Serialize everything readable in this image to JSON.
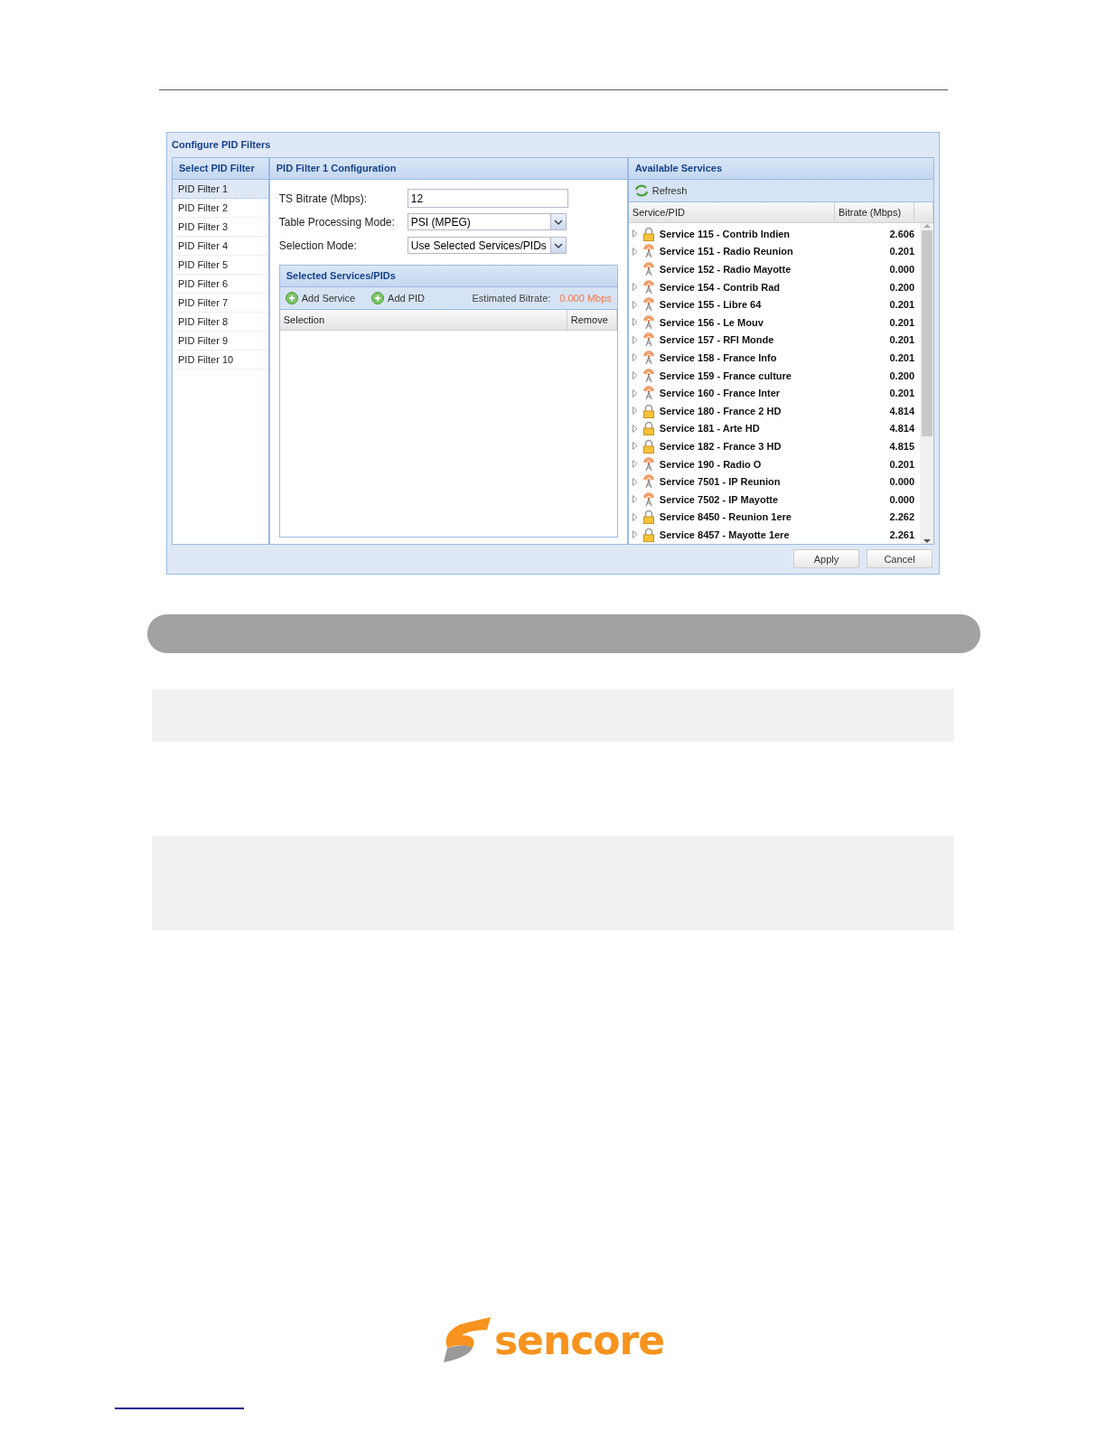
{
  "dialog": {
    "title": "Configure PID Filters",
    "filter_list": {
      "title": "Select PID Filter",
      "items": [
        {
          "label": "PID Filter 1",
          "selected": true
        },
        {
          "label": "PID Filter 2",
          "selected": false
        },
        {
          "label": "PID Filter 3",
          "selected": false
        },
        {
          "label": "PID Filter 4",
          "selected": false
        },
        {
          "label": "PID Filter 5",
          "selected": false
        },
        {
          "label": "PID Filter 6",
          "selected": false
        },
        {
          "label": "PID Filter 7",
          "selected": false
        },
        {
          "label": "PID Filter 8",
          "selected": false
        },
        {
          "label": "PID Filter 9",
          "selected": false
        },
        {
          "label": "PID Filter 10",
          "selected": false
        }
      ]
    },
    "configuration": {
      "title": "PID Filter 1 Configuration",
      "fields": [
        {
          "kind": "text",
          "label": "TS Bitrate (Mbps):",
          "value": "12"
        },
        {
          "kind": "select",
          "label": "Table Processing Mode:",
          "value": "PSI (MPEG)"
        },
        {
          "kind": "select",
          "label": "Selection Mode:",
          "value": "Use Selected Services/PIDs"
        }
      ],
      "selected": {
        "title": "Selected Services/PIDs",
        "buttons": [
          "Add Service",
          "Add PID"
        ],
        "estimate_label": "Estimated Bitrate:",
        "estimate_value": "0.000 Mbps",
        "columns": [
          "Selection",
          "Remove"
        ]
      }
    },
    "available": {
      "title": "Available Services",
      "refresh": "Refresh",
      "columns": [
        "Service/PID",
        "Bitrate (Mbps)"
      ],
      "rows": [
        {
          "kind": "lock",
          "expandable": true,
          "name": "Service 115 - Contrib Indien",
          "bitrate": "2.606"
        },
        {
          "kind": "radio",
          "expandable": true,
          "name": "Service 151 - Radio Reunion",
          "bitrate": "0.201"
        },
        {
          "kind": "radio",
          "expandable": false,
          "name": "Service 152 - Radio Mayotte",
          "bitrate": "0.000"
        },
        {
          "kind": "radio",
          "expandable": true,
          "name": "Service 154 - Contrib Rad",
          "bitrate": "0.200"
        },
        {
          "kind": "radio",
          "expandable": true,
          "name": "Service 155 - Libre 64",
          "bitrate": "0.201"
        },
        {
          "kind": "radio",
          "expandable": true,
          "name": "Service 156 - Le Mouv",
          "bitrate": "0.201"
        },
        {
          "kind": "radio",
          "expandable": true,
          "name": "Service 157 - RFI Monde",
          "bitrate": "0.201"
        },
        {
          "kind": "radio",
          "expandable": true,
          "name": "Service 158 - France Info",
          "bitrate": "0.201"
        },
        {
          "kind": "radio",
          "expandable": true,
          "name": "Service 159 - France culture",
          "bitrate": "0.200"
        },
        {
          "kind": "radio",
          "expandable": true,
          "name": "Service 160 - France Inter",
          "bitrate": "0.201"
        },
        {
          "kind": "lock",
          "expandable": true,
          "name": "Service 180 - France 2 HD",
          "bitrate": "4.814"
        },
        {
          "kind": "lock",
          "expandable": true,
          "name": "Service 181 - Arte HD",
          "bitrate": "4.814"
        },
        {
          "kind": "lock",
          "expandable": true,
          "name": "Service 182 - France 3 HD",
          "bitrate": "4.815"
        },
        {
          "kind": "radio",
          "expandable": true,
          "name": "Service 190 - Radio O",
          "bitrate": "0.201"
        },
        {
          "kind": "radio",
          "expandable": true,
          "name": "Service 7501 - IP Reunion",
          "bitrate": "0.000"
        },
        {
          "kind": "radio",
          "expandable": true,
          "name": "Service 7502 - IP Mayotte",
          "bitrate": "0.000"
        },
        {
          "kind": "lock",
          "expandable": true,
          "name": "Service 8450 - Reunion 1ere",
          "bitrate": "2.262"
        },
        {
          "kind": "lock",
          "expandable": true,
          "name": "Service 8457 - Mayotte 1ere",
          "bitrate": "2.261"
        }
      ]
    },
    "buttons": [
      "Apply",
      "Cancel"
    ]
  },
  "footer": {
    "logo": "sencore"
  }
}
